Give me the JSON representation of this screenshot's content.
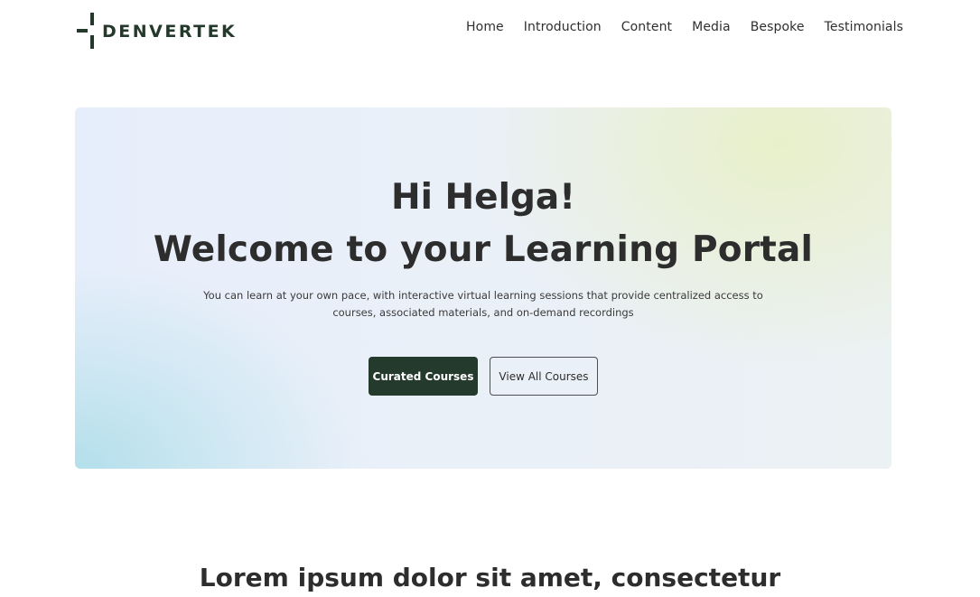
{
  "header": {
    "logo_text": "DENVERTEK",
    "nav": [
      {
        "label": "Home"
      },
      {
        "label": "Introduction"
      },
      {
        "label": "Content"
      },
      {
        "label": "Media"
      },
      {
        "label": "Bespoke"
      },
      {
        "label": "Testimonials"
      }
    ]
  },
  "hero": {
    "greeting": "Hi Helga!",
    "title": "Welcome to your Learning Portal",
    "description": "You can learn at your own pace, with interactive virtual learning sessions that provide centralized access to courses, associated materials, and on-demand recordings",
    "primary_button": "Curated Courses",
    "secondary_button": "View All Courses"
  },
  "section": {
    "heading": "Lorem ipsum dolor sit amet, consectetur"
  },
  "colors": {
    "brand_dark_green": "#233a2c",
    "text_dark": "#2d2d2d",
    "hero_blue": "#e7eefb",
    "hero_yellow": "#e8f0c8",
    "hero_cyan": "#b0deea"
  },
  "icons": {
    "logo_mark": "cross-logo-icon"
  }
}
